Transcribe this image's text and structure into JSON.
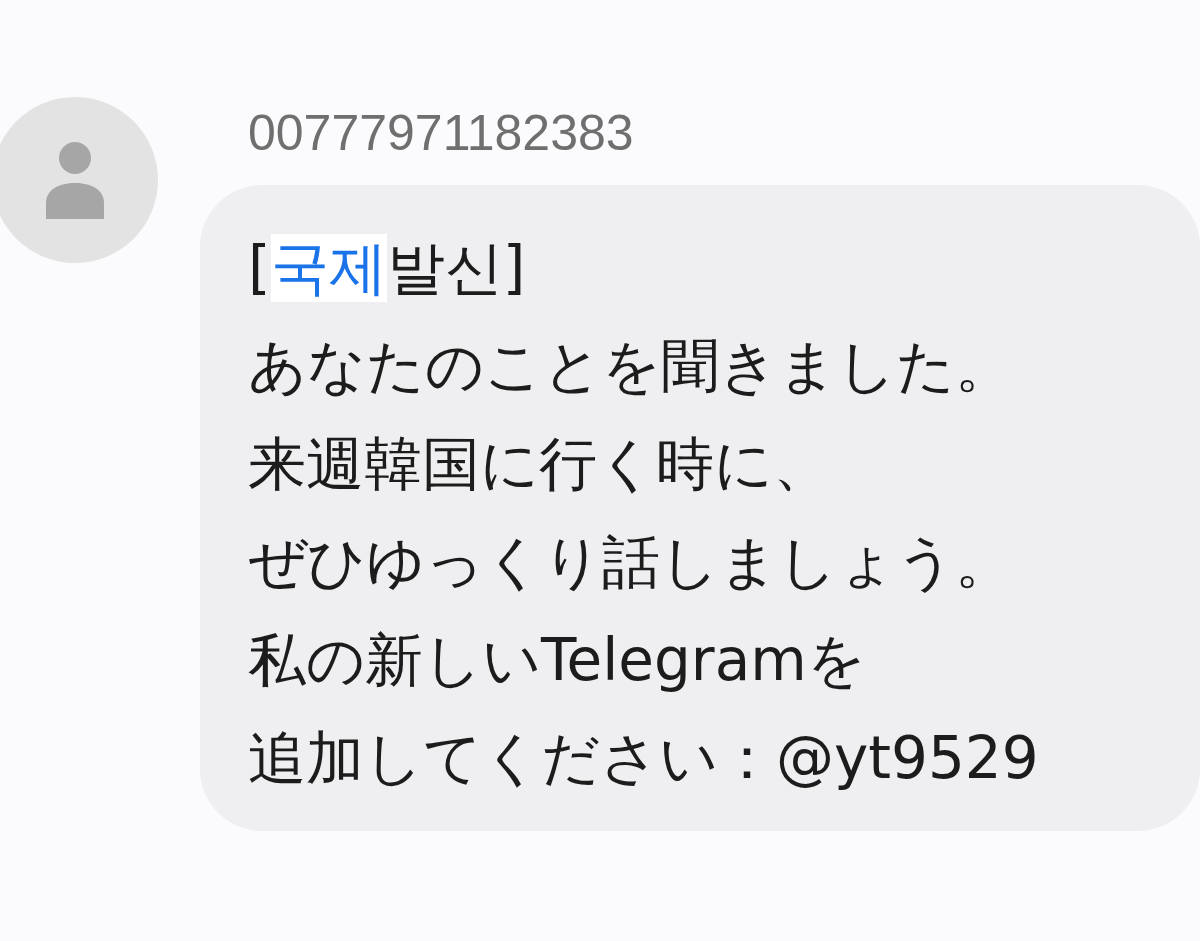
{
  "sender": "00777971182383",
  "message": {
    "lines": [
      {
        "segments": [
          {
            "text": "[",
            "highlighted": false
          },
          {
            "text": "국제",
            "highlighted": true
          },
          {
            "text": "발신]",
            "highlighted": false
          }
        ]
      },
      {
        "segments": [
          {
            "text": "あなたのことを聞きました。",
            "highlighted": false
          }
        ]
      },
      {
        "segments": [
          {
            "text": "来週韓国に行く時に、",
            "highlighted": false
          }
        ]
      },
      {
        "segments": [
          {
            "text": "ぜひゆっくり話しましょう。",
            "highlighted": false
          }
        ]
      },
      {
        "segments": [
          {
            "text": "私の新しいTelegramを",
            "highlighted": false
          }
        ]
      },
      {
        "segments": [
          {
            "text": "追加してください：@yt9529",
            "highlighted": false
          }
        ]
      }
    ]
  }
}
